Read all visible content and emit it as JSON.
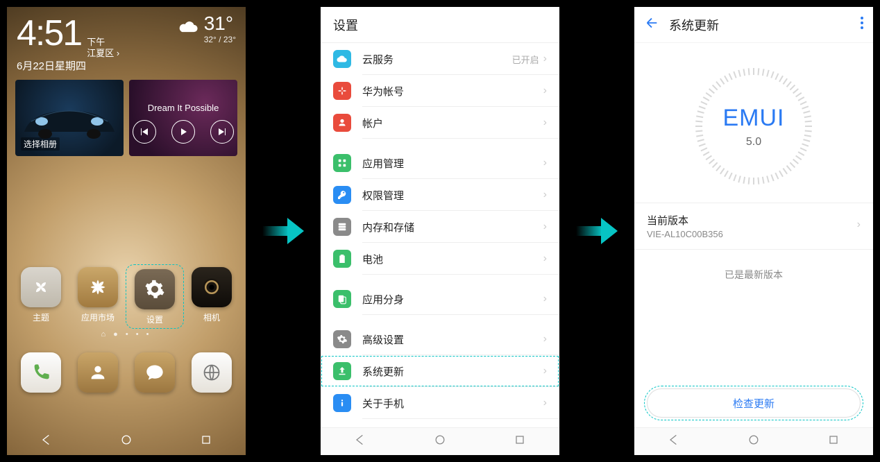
{
  "home": {
    "time": "4:51",
    "ampm": "下午",
    "location": "江夏区",
    "date": "6月22日星期四",
    "temp": "31°",
    "temp_range": "32° / 23°",
    "album_label": "选择相册",
    "music_title": "Dream It Possible",
    "apps": [
      {
        "label": "主题"
      },
      {
        "label": "应用市场"
      },
      {
        "label": "设置"
      },
      {
        "label": "相机"
      }
    ]
  },
  "settings": {
    "title": "设置",
    "rows": [
      {
        "label": "云服务",
        "meta": "已开启",
        "color": "#2fb9e4",
        "icon": "cloud"
      },
      {
        "label": "华为帐号",
        "color": "#e94b3c",
        "icon": "huawei"
      },
      {
        "label": "帐户",
        "color": "#e94b3c",
        "icon": "user"
      },
      {
        "label": "应用管理",
        "gap": true,
        "color": "#3bbf6b",
        "icon": "grid"
      },
      {
        "label": "权限管理",
        "color": "#2a8df3",
        "icon": "key"
      },
      {
        "label": "内存和存储",
        "color": "#8a8a8a",
        "icon": "storage"
      },
      {
        "label": "电池",
        "color": "#3bbf6b",
        "icon": "battery"
      },
      {
        "label": "应用分身",
        "gap": true,
        "color": "#3bbf6b",
        "icon": "clone"
      },
      {
        "label": "高级设置",
        "gap": true,
        "color": "#8a8a8a",
        "icon": "gear"
      },
      {
        "label": "系统更新",
        "color": "#3bbf6b",
        "icon": "update",
        "highlight": true
      },
      {
        "label": "关于手机",
        "color": "#2a8df3",
        "icon": "info"
      }
    ]
  },
  "update": {
    "title": "系统更新",
    "brand": "EMUI",
    "version": "5.0",
    "current_label": "当前版本",
    "current_value": "VIE-AL10C00B356",
    "latest_msg": "已是最新版本",
    "check_btn": "检查更新"
  }
}
